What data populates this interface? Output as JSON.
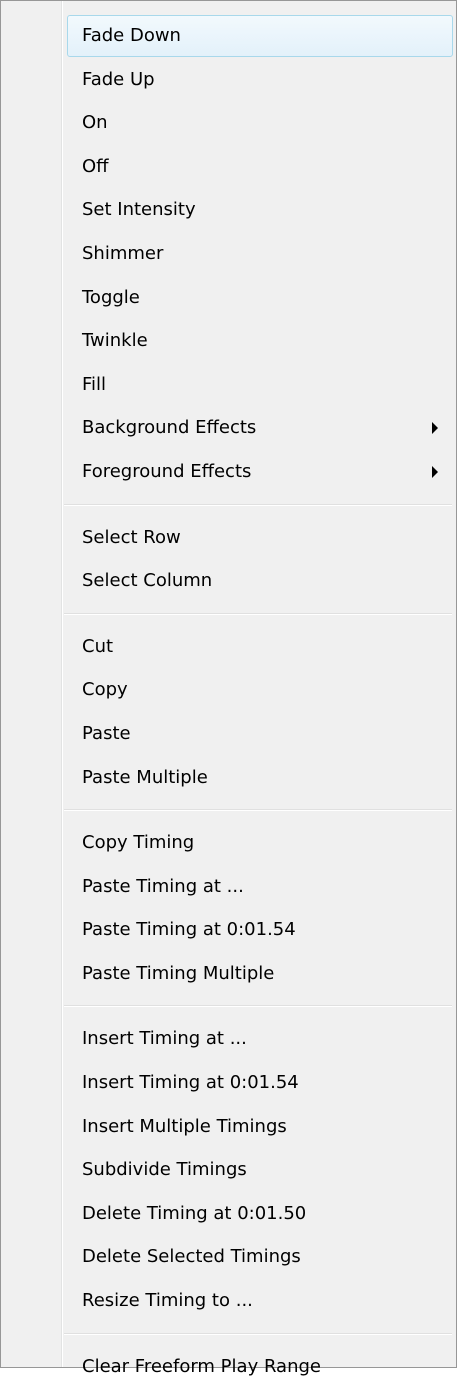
{
  "menu": {
    "items": [
      {
        "label": "Fade Down"
      },
      {
        "label": "Fade Up"
      },
      {
        "label": "On"
      },
      {
        "label": "Off"
      },
      {
        "label": "Set Intensity"
      },
      {
        "label": "Shimmer"
      },
      {
        "label": "Toggle"
      },
      {
        "label": "Twinkle"
      },
      {
        "label": "Fill"
      },
      {
        "label": "Background Effects",
        "submenu": true
      },
      {
        "label": "Foreground Effects",
        "submenu": true
      },
      {
        "label": "Select Row"
      },
      {
        "label": "Select Column"
      },
      {
        "label": "Cut"
      },
      {
        "label": "Copy"
      },
      {
        "label": "Paste"
      },
      {
        "label": "Paste Multiple"
      },
      {
        "label": "Copy Timing"
      },
      {
        "label": "Paste Timing at ..."
      },
      {
        "label": "Paste Timing at 0:01.54"
      },
      {
        "label": "Paste Timing Multiple"
      },
      {
        "label": "Insert Timing at ..."
      },
      {
        "label": "Insert Timing at 0:01.54"
      },
      {
        "label": "Insert Multiple Timings"
      },
      {
        "label": "Subdivide Timings"
      },
      {
        "label": "Delete Timing at 0:01.50"
      },
      {
        "label": "Delete Selected Timings"
      },
      {
        "label": "Resize Timing to ..."
      },
      {
        "label": "Clear Freeform Play Range"
      }
    ],
    "highlighted_label": "Fade Down",
    "colors": {
      "background": "#f0f0f0",
      "border": "#979797",
      "highlight_border": "#a8d8eb"
    },
    "icons": {
      "submenu": "submenu-arrow-icon"
    }
  }
}
